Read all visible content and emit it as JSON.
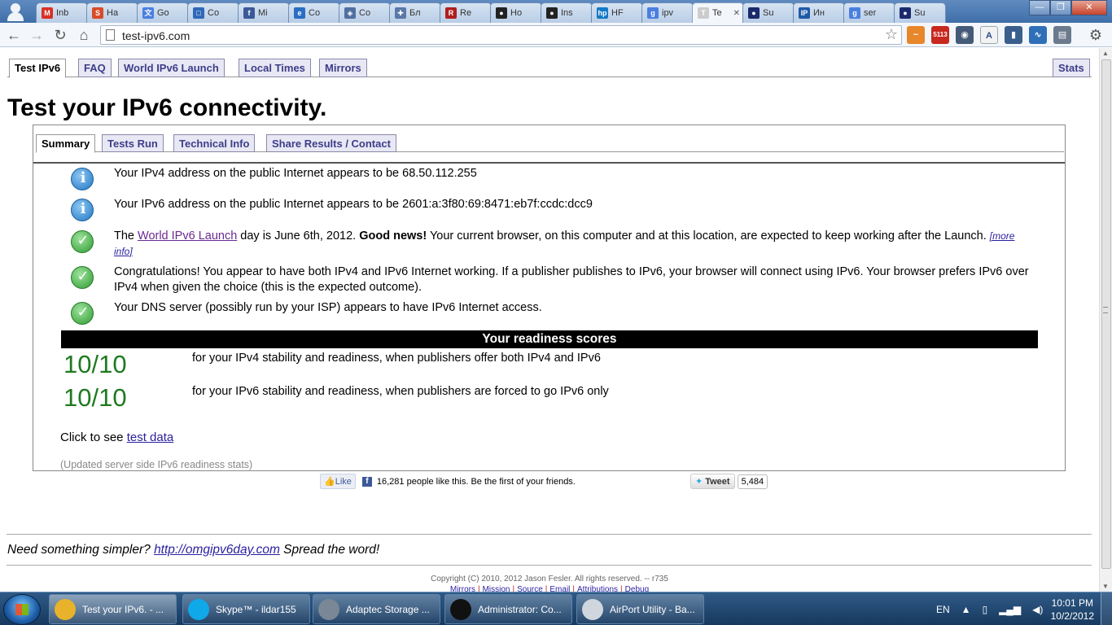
{
  "browser": {
    "tabs": [
      {
        "label": "Inb",
        "favicon": "gmail-icon",
        "color": "#d93025",
        "glyph": "M"
      },
      {
        "label": "Ha",
        "favicon": "reddit-icon",
        "color": "#d94a2a",
        "glyph": "S"
      },
      {
        "label": "Go",
        "favicon": "google-translate-icon",
        "color": "#4a7fe0",
        "glyph": "文"
      },
      {
        "label": "Co",
        "favicon": "chat-icon",
        "color": "#2f68b8",
        "glyph": "□"
      },
      {
        "label": "Mi",
        "favicon": "facebook-icon",
        "color": "#3b5998",
        "glyph": "f"
      },
      {
        "label": "Co",
        "favicon": "edge-icon",
        "color": "#2a6ec4",
        "glyph": "e"
      },
      {
        "label": "Co",
        "favicon": "shield-icon",
        "color": "#4f6fa0",
        "glyph": "◈"
      },
      {
        "label": "Бл",
        "favicon": "habr-icon",
        "color": "#5a78a8",
        "glyph": "✚"
      },
      {
        "label": "Re",
        "favicon": "redhat-icon",
        "color": "#b01d1d",
        "glyph": "R"
      },
      {
        "label": "Ho",
        "favicon": "github-icon",
        "color": "#222222",
        "glyph": "●"
      },
      {
        "label": "Ins",
        "favicon": "github-icon",
        "color": "#222222",
        "glyph": "●"
      },
      {
        "label": "HF",
        "favicon": "hp-icon",
        "color": "#1479c7",
        "glyph": "hp"
      },
      {
        "label": "ipv",
        "favicon": "google-icon",
        "color": "#4a7fe0",
        "glyph": "g"
      },
      {
        "label": "Te",
        "favicon": "test-ipv6-icon",
        "color": "#cccccc",
        "glyph": "T",
        "active": true
      },
      {
        "label": "Su",
        "favicon": "superuser-icon",
        "color": "#1a2a6c",
        "glyph": "●"
      },
      {
        "label": "Ин",
        "favicon": "ip-icon",
        "color": "#1f5aa8",
        "glyph": "IP"
      },
      {
        "label": "ser",
        "favicon": "google-icon",
        "color": "#4a7fe0",
        "glyph": "g"
      },
      {
        "label": "Su",
        "favicon": "superuser-icon",
        "color": "#1a2a6c",
        "glyph": "●"
      }
    ],
    "url": "test-ipv6.com",
    "extensions": [
      {
        "name": "rss-icon",
        "color": "#e8862a",
        "glyph": "~"
      },
      {
        "name": "gmail-checker-icon",
        "color": "#c8281e",
        "glyph": "5113"
      },
      {
        "name": "camera-icon",
        "color": "#455a78",
        "glyph": "◉"
      },
      {
        "name": "font-icon",
        "color": "#f2f2f2",
        "glyph": "A"
      },
      {
        "name": "phone-icon",
        "color": "#3a5f8c",
        "glyph": "▮"
      },
      {
        "name": "chart-icon",
        "color": "#2f6fb8",
        "glyph": "∿"
      },
      {
        "name": "print-icon",
        "color": "#6b7a8c",
        "glyph": "▤"
      }
    ]
  },
  "page": {
    "top_tabs": [
      "Test IPv6",
      "FAQ",
      "World IPv6 Launch",
      "Local Times",
      "Mirrors"
    ],
    "stats_tab": "Stats",
    "title": "Test your IPv6 connectivity.",
    "sub_tabs": [
      "Summary",
      "Tests Run",
      "Technical Info",
      "Share Results / Contact"
    ],
    "results": {
      "ipv4": "Your IPv4 address on the public Internet appears to be 68.50.112.255",
      "ipv6": "Your IPv6 address on the public Internet appears to be 2601:a:3f80:69:8471:eb7f:ccdc:dcc9",
      "launch_pre": "The ",
      "launch_link": "World IPv6 Launch",
      "launch_mid": " day is June 6th, 2012. ",
      "launch_bold": "Good news!",
      "launch_post": " Your current browser, on this computer and at this location, are expected to keep working after the Launch. ",
      "more_info": "[more info]",
      "congrats": "Congratulations! You appear to have both IPv4 and IPv6 Internet working. If a publisher publishes to IPv6, your browser will connect using IPv6. Your browser prefers IPv6 over IPv4 when given the choice (this is the expected outcome).",
      "dns": "Your DNS server (possibly run by your ISP) appears to have IPv6 Internet access."
    },
    "readiness": {
      "header": "Your readiness scores",
      "scores": [
        {
          "value": "10/10",
          "text": "for your IPv4 stability and readiness, when publishers offer both IPv4 and IPv6"
        },
        {
          "value": "10/10",
          "text": "for your IPv6 stability and readiness, when publishers are forced to go IPv6 only"
        }
      ]
    },
    "click_to_see": "Click to see ",
    "test_data_link": "test data",
    "updated_stats": "(Updated server side IPv6 readiness stats)",
    "social": {
      "like": "Like",
      "fb_text": "16,281 people like this. Be the first of your friends.",
      "tweet": "Tweet",
      "tweet_count": "5,484"
    },
    "simpler_pre": "Need something simpler? ",
    "simpler_link": "http://omgipv6day.com",
    "simpler_post": " Spread the word!",
    "copyright": "Copyright (C) 2010, 2012 Jason Fesler. All rights reserved. -- r735",
    "footer_links": [
      "Mirrors",
      "Mission",
      "Source",
      "Email",
      "Attributions",
      "Debug"
    ]
  },
  "taskbar": {
    "items": [
      {
        "label": "Test your IPv6. - ...",
        "icon": "chrome-icon",
        "color": "#e8b32a",
        "active": true
      },
      {
        "label": "Skype™ - ildar155",
        "icon": "skype-icon",
        "color": "#0fa8e8"
      },
      {
        "label": "Adaptec Storage ...",
        "icon": "storage-icon",
        "color": "#7a8796"
      },
      {
        "label": "Administrator: Co...",
        "icon": "cmd-icon",
        "color": "#111111"
      },
      {
        "label": "AirPort Utility - Ba...",
        "icon": "airport-icon",
        "color": "#cfd6de"
      }
    ],
    "language": "EN",
    "time": "10:01 PM",
    "date": "10/2/2012"
  }
}
